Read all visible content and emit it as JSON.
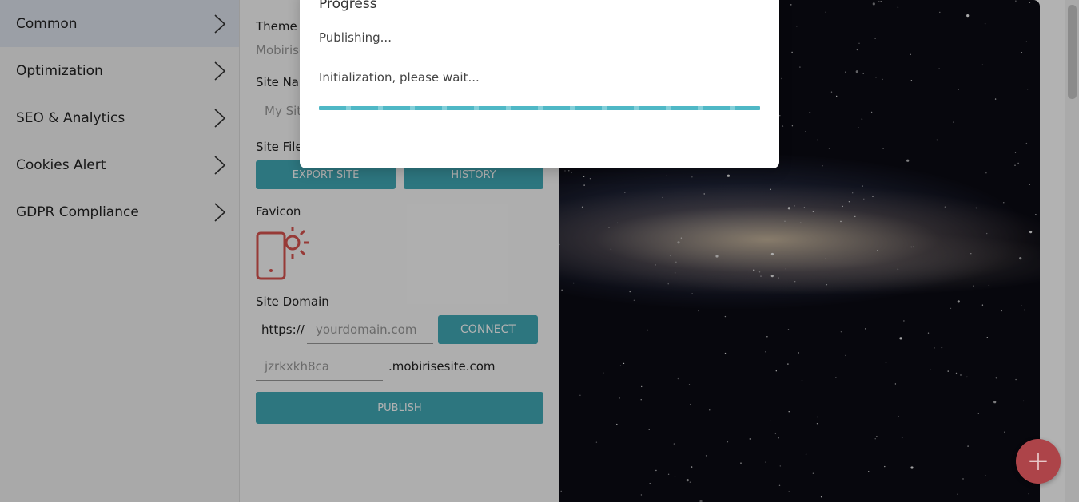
{
  "sidebar": {
    "items": [
      {
        "label": "Common"
      },
      {
        "label": "Optimization"
      },
      {
        "label": "SEO & Analytics"
      },
      {
        "label": "Cookies Alert"
      },
      {
        "label": "GDPR Compliance"
      }
    ]
  },
  "panel": {
    "theme_label": "Theme Name",
    "theme_value": "Mobirise",
    "site_name_label": "Site Name",
    "site_name_placeholder": "My Site",
    "site_files_label": "Site Files",
    "export_label": "EXPORT SITE",
    "history_label": "HISTORY",
    "favicon_label": "Favicon",
    "domain_label": "Site Domain",
    "https_prefix": "https://",
    "domain_placeholder": "yourdomain.com",
    "connect_label": "CONNECT",
    "subdomain_value": "jzrkxkh8ca",
    "subdomain_suffix": ".mobirisesite.com",
    "publish_label": "PUBLISH"
  },
  "modal": {
    "title": "Progress",
    "subtitle": "Publishing...",
    "status": "Initialization, please wait..."
  },
  "fab": {
    "icon": "plus-icon",
    "color": "#ad4449"
  },
  "colors": {
    "accent": "#41a9b6",
    "favicon": "#d9534f"
  }
}
